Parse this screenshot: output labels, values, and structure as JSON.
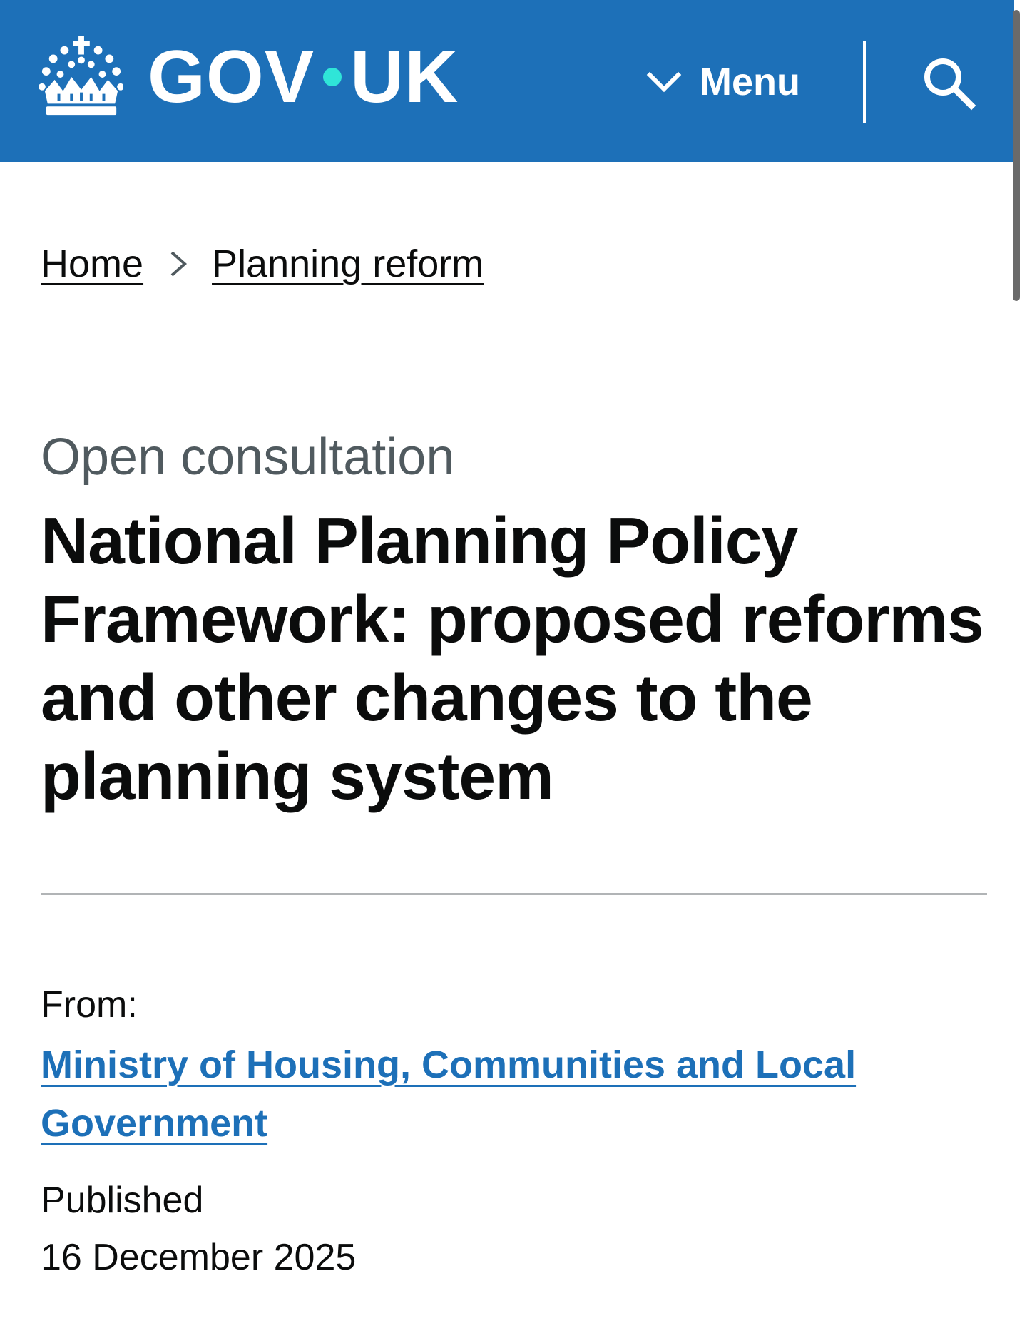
{
  "header": {
    "logo_text_left": "GOV",
    "logo_text_right": "UK",
    "menu_label": "Menu",
    "brand_color": "#1d70b8",
    "dot_color": "#2fe5d8",
    "icons": {
      "logo": "crown-icon",
      "menu": "chevron-down-icon",
      "search": "search-icon"
    }
  },
  "breadcrumb": {
    "items": [
      {
        "label": "Home"
      },
      {
        "label": "Planning reform"
      }
    ]
  },
  "main": {
    "caption": "Open consultation",
    "title": "National Planning Policy Framework: proposed reforms and other changes to the planning system"
  },
  "metadata": {
    "from_label": "From:",
    "organisation": "Ministry of Housing, Communities and Local Government",
    "published_label": "Published",
    "published_date": "16 December 2025",
    "link_color": "#1d70b8"
  }
}
